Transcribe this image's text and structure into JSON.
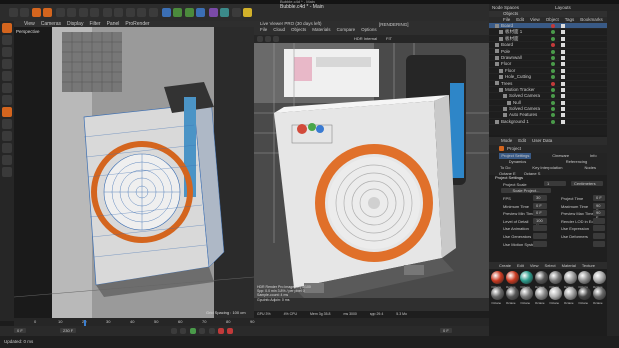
{
  "window": {
    "title": "Bubble.c4d * - Main",
    "node_spaces": "Node Spaces",
    "layouts": "Layouts"
  },
  "left_view": {
    "menu": [
      "View",
      "Cameras",
      "Display",
      "Filter",
      "Panel",
      "ProRender"
    ],
    "label": "Perspective",
    "grid_spacing": "Grid Spacing : 100 cm"
  },
  "viewer": {
    "title": "Live Viewer PRO (30 days left)",
    "menu": [
      "File",
      "Cloud",
      "Objects",
      "Materials",
      "Compare",
      "Options"
    ],
    "hdr_select": "HDR Internal",
    "fit": "FIT",
    "status": "[RENDERING]",
    "info_lines": [
      "HDR Render Pro Image(HT) 5/100",
      "Spp: 0.0 min 3.8% / per pixel 0",
      "Sample-count: 4 ms",
      "GpuInfo Adjoin: 0 ms"
    ],
    "stats": [
      "GPU 3%",
      "4% CPU",
      "Mem 3g 35.8",
      "ms 3000",
      "spp 29.4",
      "5.3 Mo"
    ]
  },
  "objects": {
    "header": "Objects",
    "menu": [
      "File",
      "Edit",
      "View",
      "Object",
      "Tags",
      "Bookmarks"
    ],
    "items": [
      "Board",
      "板材面 1",
      "板材面",
      "Board",
      "Pole",
      "Drawnwall",
      "Floor",
      "Floor",
      "Hole_Cutting",
      "Trees",
      "Motion Tracker",
      "Solved Camera",
      "Null",
      "Solved Camera",
      "Auto Features",
      "Background 1"
    ]
  },
  "attributes": {
    "menu": [
      "Mode",
      "Edit",
      "User Data"
    ],
    "section": "Project",
    "tabs": [
      "Project Settings",
      "Cineware",
      "Info",
      "Dynamics",
      "Referencing",
      "To Do",
      "Key Interpolation",
      "Nodes"
    ],
    "tab_extra": [
      "Octane E",
      "Octane S"
    ],
    "heading": "Project Settings",
    "fields": [
      {
        "label": "Project Scale",
        "value": "1",
        "unit": "Centimeters"
      },
      {
        "label": "FPS",
        "value": "30",
        "r_label": "Project Time",
        "r_value": "0 F"
      },
      {
        "label": "Minimum Time",
        "value": "0 F",
        "r_label": "Maximum Time",
        "r_value": "90 F"
      },
      {
        "label": "Preview Min Time",
        "value": "0 F",
        "r_label": "Preview Max Time",
        "r_value": "90 F"
      },
      {
        "label": "Level of Detail",
        "value": "100 %",
        "r_label": "Render LOD in Editor",
        "r_value": ""
      },
      {
        "label": "Use Animation",
        "value": "",
        "r_label": "Use Expression",
        "r_value": ""
      },
      {
        "label": "Use Generators",
        "value": "",
        "r_label": "Use Deformers",
        "r_value": ""
      },
      {
        "label": "Use Motion System",
        "value": "",
        "r_label": "",
        "r_value": ""
      }
    ],
    "scale_btn": "Scale Project..."
  },
  "materials": {
    "menu": [
      "Create",
      "Edit",
      "View",
      "Select",
      "Material",
      "Texture",
      "Cycles 4D"
    ],
    "names": [
      "Octane",
      "Octane",
      "Octane",
      "Octane",
      "Octane",
      "Octane",
      "Octane",
      "Octane",
      "Octane",
      "Octane",
      "Octane",
      "Octane",
      "Octane",
      "Octane",
      "Octane",
      "Octane"
    ]
  },
  "timeline": {
    "ticks": [
      "0",
      "10",
      "20",
      "30",
      "40",
      "50",
      "60",
      "70",
      "80",
      "90"
    ],
    "frame_start": "0 F",
    "frame_end": "230 F",
    "current": "0 F",
    "status": "Updated: 0 ms"
  },
  "colors": {
    "accent": "#d4651e",
    "select": "#395a86",
    "bg": "#1c1c1c"
  }
}
